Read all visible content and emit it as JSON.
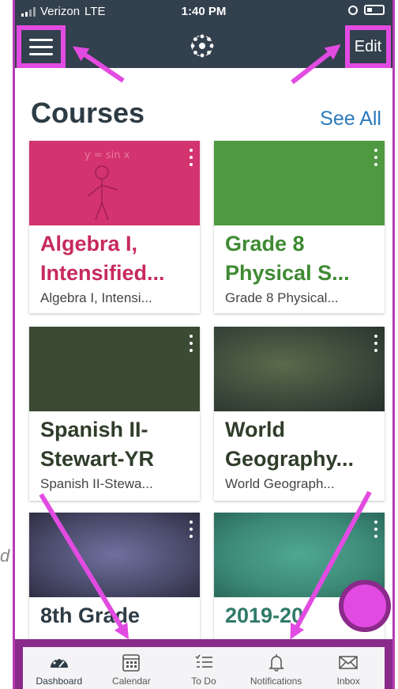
{
  "status": {
    "carrier": "Verizon",
    "network": "LTE",
    "time": "1:40 PM"
  },
  "nav": {
    "edit_label": "Edit",
    "menu_icon": "hamburger-icon",
    "logo_icon": "canvas-logo-icon"
  },
  "header": {
    "title": "Courses",
    "see_all": "See All"
  },
  "courses": [
    {
      "title_line1": "Algebra I,",
      "title_line2": "Intensified...",
      "subtitle": "Algebra I, Intensi...",
      "color": "#d3336e",
      "title_color": "#c72a5c",
      "image_text": "y = sin x"
    },
    {
      "title_line1": "Grade 8",
      "title_line2": "Physical S...",
      "subtitle": "Grade 8 Physical...",
      "color": "#4f9a41",
      "title_color": "#3f8a33"
    },
    {
      "title_line1": "Spanish II-",
      "title_line2": "Stewart-YR",
      "subtitle": "Spanish II-Stewa...",
      "color": "#3b4a33",
      "title_color": "#2f3d2a"
    },
    {
      "title_line1": "World",
      "title_line2": "Geography...",
      "subtitle": "World Geograph...",
      "color": "#3c4a3b",
      "title_color": "#2f3d2a"
    },
    {
      "title_line1": "8th Grade",
      "title_line2": "",
      "subtitle": "",
      "color": "#5a5a78",
      "title_color": "#2d3b45"
    },
    {
      "title_line1": "2019-20",
      "title_line2": "",
      "subtitle": "",
      "color": "#3d8a78",
      "title_color": "#2f7a68"
    }
  ],
  "tabs": [
    {
      "label": "Dashboard",
      "icon": "dashboard-icon"
    },
    {
      "label": "Calendar",
      "icon": "calendar-icon"
    },
    {
      "label": "To Do",
      "icon": "todo-icon"
    },
    {
      "label": "Notifications",
      "icon": "bell-icon"
    },
    {
      "label": "Inbox",
      "icon": "inbox-icon"
    }
  ],
  "colors": {
    "nav_bg": "#33404d",
    "highlight": "#e24be2",
    "link": "#2b7abc"
  },
  "side_text": "d"
}
